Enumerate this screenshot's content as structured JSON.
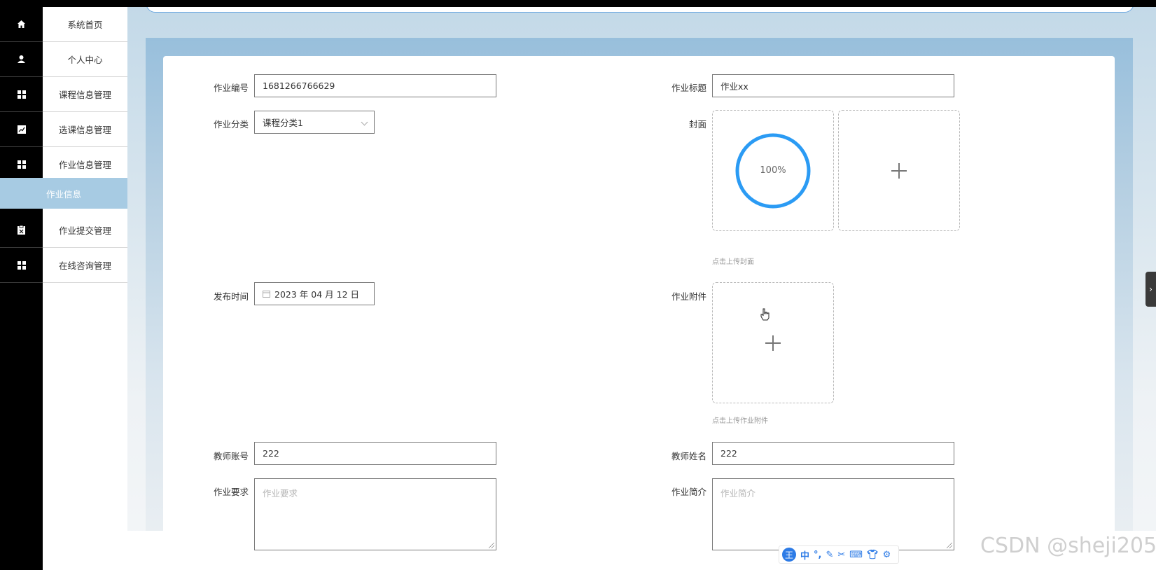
{
  "sidebar": {
    "items": [
      {
        "label": "系统首页",
        "icon": "home-icon"
      },
      {
        "label": "个人中心",
        "icon": "user-icon"
      },
      {
        "label": "课程信息管理",
        "icon": "grid-icon"
      },
      {
        "label": "选课信息管理",
        "icon": "chart-icon"
      },
      {
        "label": "作业信息管理",
        "icon": "grid-icon"
      },
      {
        "label": "作业信息",
        "icon": "",
        "active": true
      },
      {
        "label": "作业提交管理",
        "icon": "clipboard-icon"
      },
      {
        "label": "在线咨询管理",
        "icon": "grid-icon"
      }
    ]
  },
  "form": {
    "hw_no": {
      "label": "作业编号",
      "value": "1681266766629"
    },
    "hw_title": {
      "label": "作业标题",
      "value": "作业xx"
    },
    "category": {
      "label": "作业分类",
      "value": "课程分类1"
    },
    "cover": {
      "label": "封面",
      "progress": "100%",
      "tip": "点击上传封面"
    },
    "publish_time": {
      "label": "发布时间",
      "value": "2023 年 04 月 12 日"
    },
    "attachment": {
      "label": "作业附件",
      "tip": "点击上传作业附件"
    },
    "teacher_account": {
      "label": "教师账号",
      "value": "222"
    },
    "teacher_name": {
      "label": "教师姓名",
      "value": "222"
    },
    "requirement": {
      "label": "作业要求",
      "placeholder": "作业要求"
    },
    "intro": {
      "label": "作业简介",
      "placeholder": "作业简介"
    }
  },
  "ime": {
    "logo": "王",
    "mode": "中"
  },
  "watermark": "CSDN @sheji205",
  "colors": {
    "accent": "#409eff",
    "active_menu": "#a7cbe3"
  }
}
